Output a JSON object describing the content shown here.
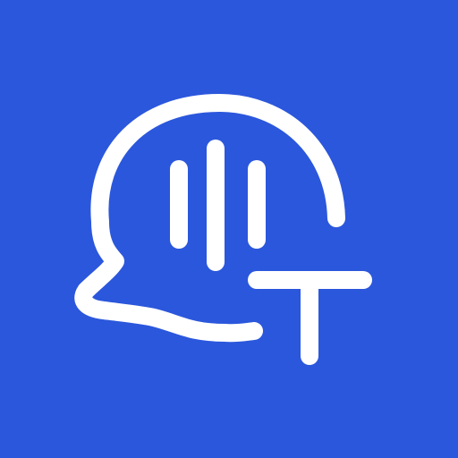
{
  "icon": {
    "name": "speech-to-text-icon",
    "background_color": "#2B57DC",
    "foreground_color": "#FFFFFF",
    "symbols": [
      "speech-bubble-icon",
      "sound-wave-icon",
      "text-t-icon"
    ]
  }
}
